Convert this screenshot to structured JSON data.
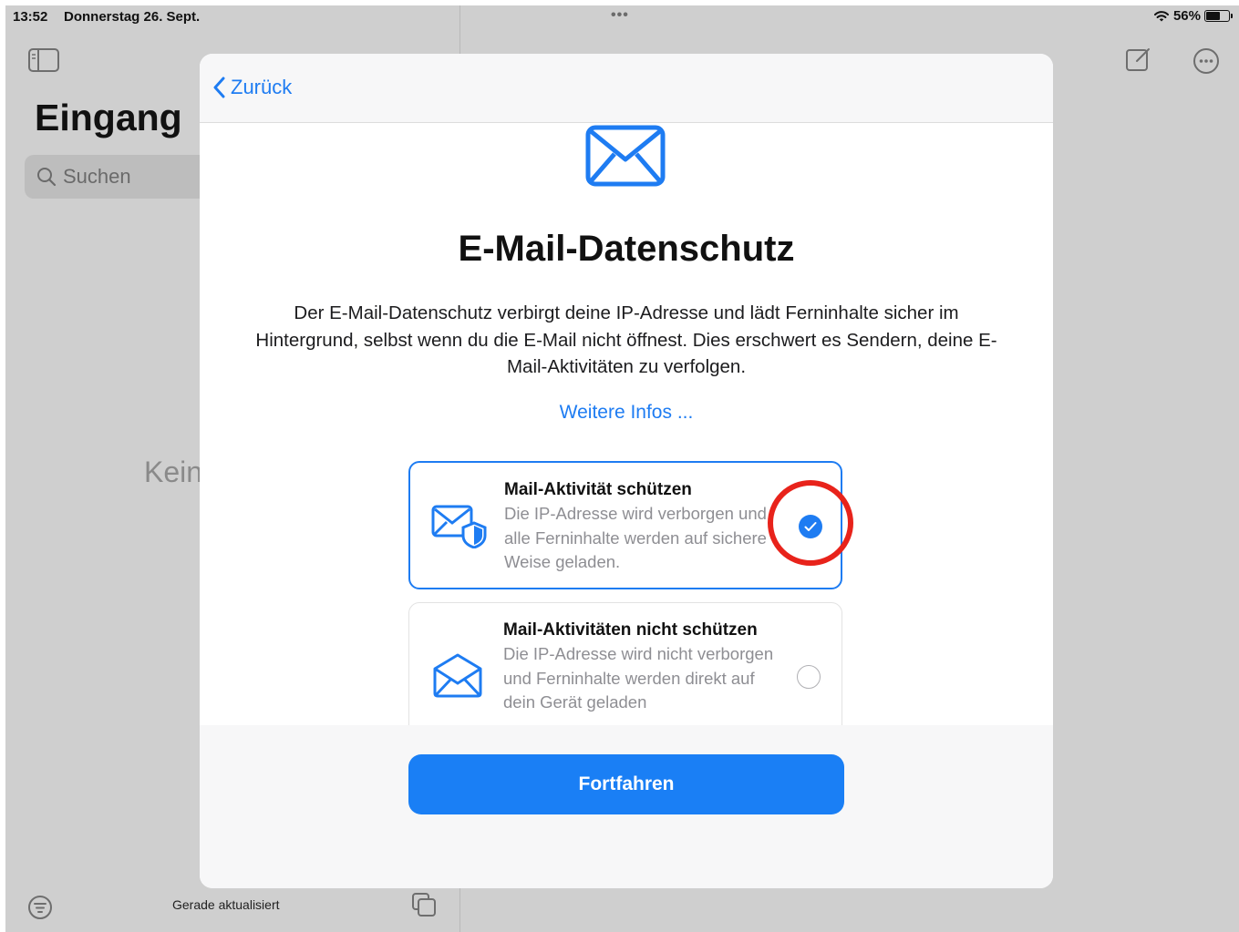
{
  "statusbar": {
    "time": "13:52",
    "date": "Donnerstag 26. Sept.",
    "multitask_dots": "•••",
    "battery": "56%",
    "battery_level": 0.56
  },
  "background": {
    "inbox_title": "Eingang",
    "search_placeholder": "Suchen",
    "empty_text": "Kein",
    "bottom_status": "Gerade aktualisiert"
  },
  "modal": {
    "back_label": "Zurück",
    "title": "E-Mail-Datenschutz",
    "description": "Der E-Mail-Datenschutz verbirgt deine IP-Adresse und lädt Ferninhalte sicher im Hintergrund, selbst wenn du die E-Mail nicht öffnest. Dies erschwert es Sendern, deine E-Mail-Aktivitäten zu verfolgen.",
    "more_info": "Weitere Infos ...",
    "options": [
      {
        "title": "Mail-Aktivität schützen",
        "body": "Die IP-Adresse wird verborgen und alle Ferninhalte werden auf sichere Weise geladen.",
        "selected": true,
        "icon": "envelope-shield-icon"
      },
      {
        "title": "Mail-Aktivitäten nicht schützen",
        "body": "Die IP-Adresse wird nicht verborgen und Ferninhalte werden direkt auf dein Gerät geladen",
        "selected": false,
        "icon": "open-envelope-icon"
      }
    ],
    "continue_label": "Fortfahren"
  },
  "colors": {
    "accent": "#1e7cf2",
    "highlight": "#e8231b",
    "dimmed_background": "#cfcfcf"
  }
}
